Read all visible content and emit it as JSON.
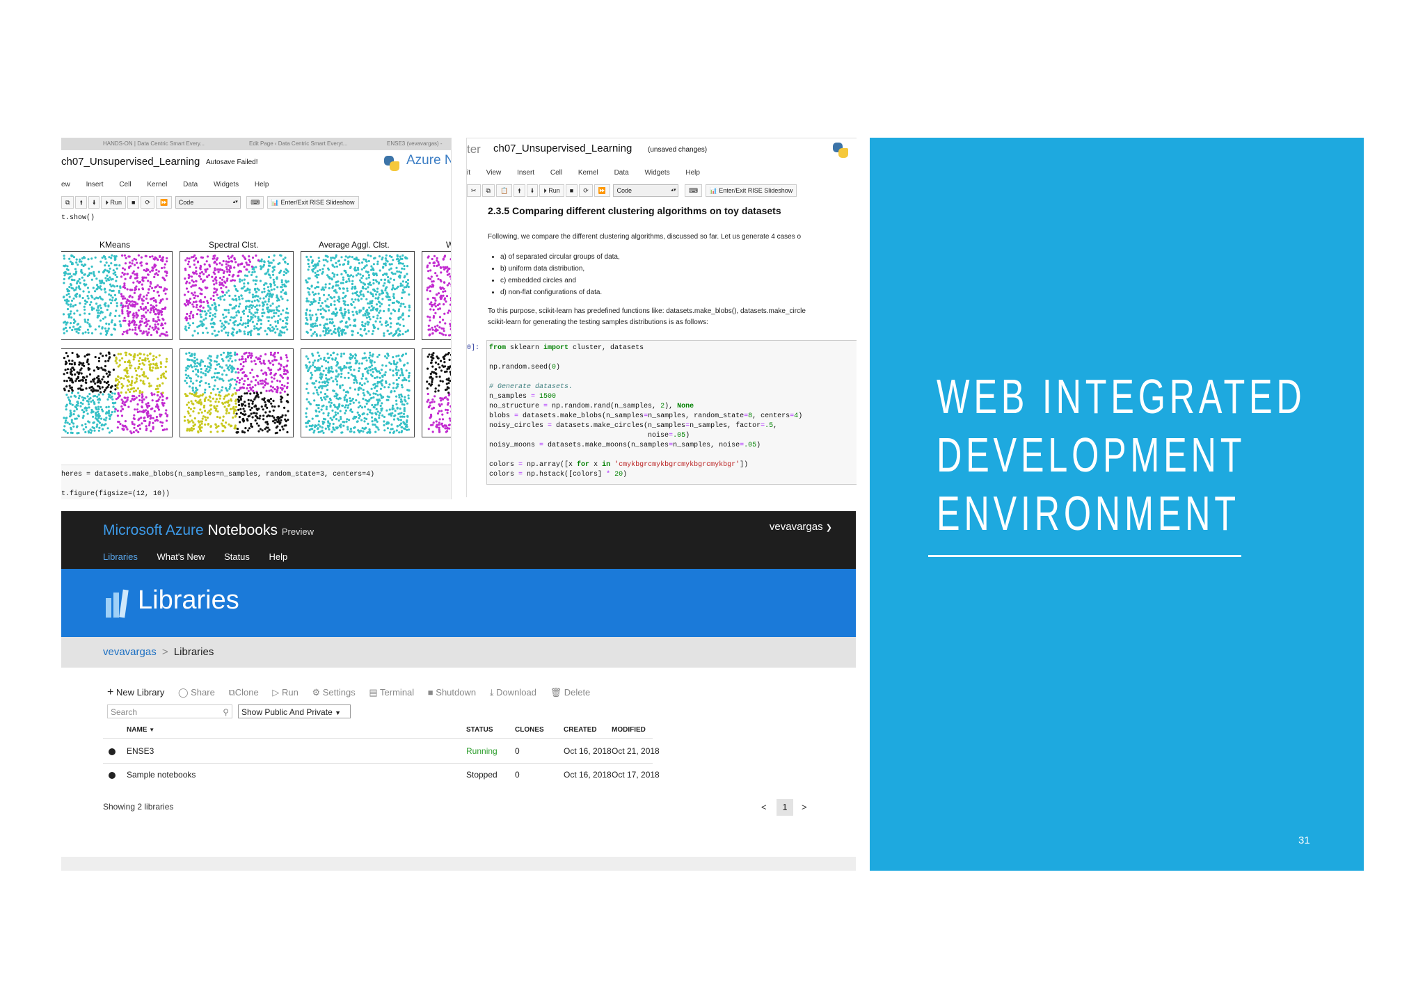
{
  "jupyter_left": {
    "browser_tabs": [
      "HANDS-ON | Data Centric Smart Every...",
      "Edit Page ‹ Data Centric Smart Everyt...",
      "ENSE3 (vevavargas) -"
    ],
    "notebook_title": "ch07_Unsupervised_Learning",
    "autosave": "Autosave Failed!",
    "brand": "Azure N",
    "menu": [
      "ew",
      "Insert",
      "Cell",
      "Kernel",
      "Data",
      "Widgets",
      "Help"
    ],
    "toolbar": {
      "run": "Run",
      "cell_type": "Code",
      "rise": "Enter/Exit RISE Slideshow"
    },
    "code_top": "t.show()",
    "plot_titles": [
      "KMeans",
      "Spectral Clst.",
      "Average Aggl. Clst.",
      "W"
    ],
    "code_bottom_1": "heres = datasets.make_blobs(n_samples=n_samples, random_state=3, centers=4)",
    "code_bottom_2": "t.figure(figsize=(12, 10))"
  },
  "jupyter_right": {
    "logo_fragment": "ter",
    "notebook_title": "ch07_Unsupervised_Learning",
    "unsaved": "(unsaved changes)",
    "menu": [
      "it",
      "View",
      "Insert",
      "Cell",
      "Kernel",
      "Data",
      "Widgets",
      "Help"
    ],
    "toolbar": {
      "run": "Run",
      "cell_type": "Code",
      "rise": "Enter/Exit RISE Slideshow"
    },
    "heading": "2.3.5 Comparing different clustering algorithms on toy datasets",
    "para1": "Following, we compare the different clustering algorithms, discussed so far. Let us generate 4 cases o",
    "bullets": [
      "a) of separated circular groups of data,",
      "b) uniform data distribution,",
      "c) embedded circles and",
      "d) non-flat configurations of data."
    ],
    "para2a": "To this purpose, scikit-learn has predefined functions like: datasets.make_blobs(), datasets.make_circle",
    "para2b": "scikit-learn for generating the testing samples distributions is as follows:",
    "prompt": "0]:"
  },
  "azure": {
    "brand_blue": "Microsoft Azure",
    "brand_white": "Notebooks",
    "brand_preview": "Preview",
    "user": "vevavargas",
    "nav": [
      "Libraries",
      "What's New",
      "Status",
      "Help"
    ],
    "banner_title": "Libraries",
    "breadcrumb_user": "vevavargas",
    "breadcrumb_sep": ">",
    "breadcrumb_page": "Libraries",
    "actions": [
      "New Library",
      "Share",
      "Clone",
      "Run",
      "Settings",
      "Terminal",
      "Shutdown",
      "Download",
      "Delete"
    ],
    "search_placeholder": "Search",
    "filter": "Show Public And Private",
    "columns": [
      "NAME",
      "STATUS",
      "CLONES",
      "CREATED",
      "MODIFIED"
    ],
    "rows": [
      {
        "name": "ENSE3",
        "status": "Running",
        "clones": "0",
        "created": "Oct 16, 2018",
        "modified": "Oct 21, 2018"
      },
      {
        "name": "Sample notebooks",
        "status": "Stopped",
        "clones": "0",
        "created": "Oct 16, 2018",
        "modified": "Oct 17, 2018"
      }
    ],
    "showing": "Showing 2 libraries",
    "page": "1",
    "prev": "<",
    "next": ">",
    "colors": {
      "topbar": "#1e1e1e",
      "banner": "#1b7ad9",
      "running": "#2e9e2e"
    }
  },
  "slide": {
    "title_lines": [
      "WEB INTEGRATED",
      "DEVELOPMENT",
      "ENVIRONMENT"
    ],
    "slide_number": "31",
    "color": "#1ea9df"
  }
}
